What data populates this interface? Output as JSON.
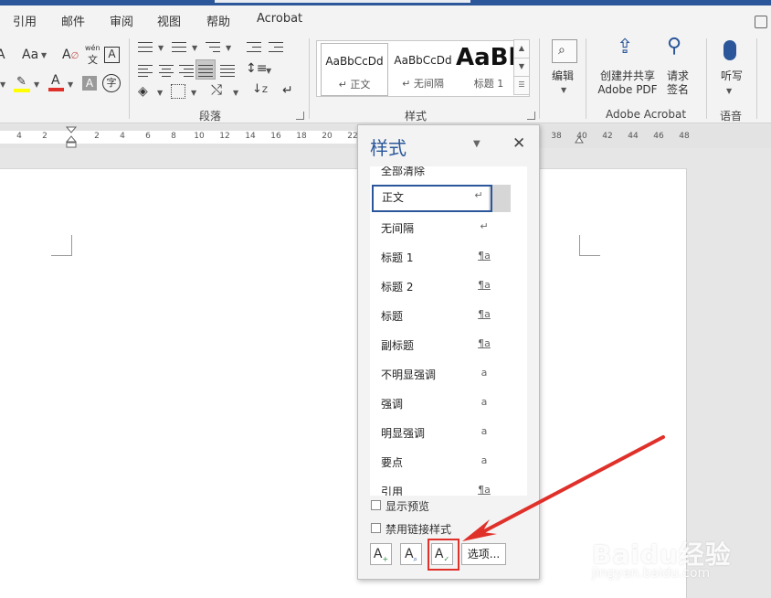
{
  "tabs": [
    "引用",
    "邮件",
    "审阅",
    "视图",
    "帮助",
    "Acrobat"
  ],
  "ribbon": {
    "groups": {
      "paragraph": "段落",
      "styles": "样式",
      "adobe": "Adobe Acrobat",
      "voice": "语音"
    },
    "gallery": [
      {
        "preview": "AaBbCcDd",
        "name": "↵ 正文"
      },
      {
        "preview": "AaBbCcDd",
        "name": "↵ 无间隔"
      },
      {
        "preview": "AaBl",
        "name": "标题 1"
      }
    ],
    "edit_label": "编辑",
    "create_share_line1": "创建并共享",
    "create_share_line2": "Adobe PDF",
    "sign_line1": "请求",
    "sign_line2": "签名",
    "dictate_label": "听写",
    "font_aa": "Aa",
    "wen": "wén",
    "wen_char": "文"
  },
  "ruler": {
    "left_numbers": [
      "4",
      "2"
    ],
    "numbers": [
      "2",
      "4",
      "6",
      "8",
      "10",
      "12",
      "14",
      "16",
      "18",
      "20",
      "22"
    ],
    "right_numbers": [
      "38",
      "40",
      "42",
      "44",
      "46",
      "48"
    ]
  },
  "styles_pane": {
    "title": "样式",
    "clear_all": "全部清除",
    "items": [
      {
        "label": "正文",
        "marker": "↵",
        "selected": true
      },
      {
        "label": "无间隔",
        "marker": "↵"
      },
      {
        "label": "标题 1",
        "marker": "¶a"
      },
      {
        "label": "标题 2",
        "marker": "¶a"
      },
      {
        "label": "标题",
        "marker": "¶a"
      },
      {
        "label": "副标题",
        "marker": "¶a"
      },
      {
        "label": "不明显强调",
        "marker": "a"
      },
      {
        "label": "强调",
        "marker": "a"
      },
      {
        "label": "明显强调",
        "marker": "a"
      },
      {
        "label": "要点",
        "marker": "a"
      },
      {
        "label": "引用",
        "marker": "¶a"
      }
    ],
    "show_preview": "显示预览",
    "disable_linked": "禁用链接样式",
    "options_button": "选项..."
  },
  "watermark": {
    "brand": "Baidu经验",
    "url": "jingyan.baidu.com"
  },
  "colors": {
    "accent": "#2b579a",
    "highlight": "#e0302a"
  }
}
